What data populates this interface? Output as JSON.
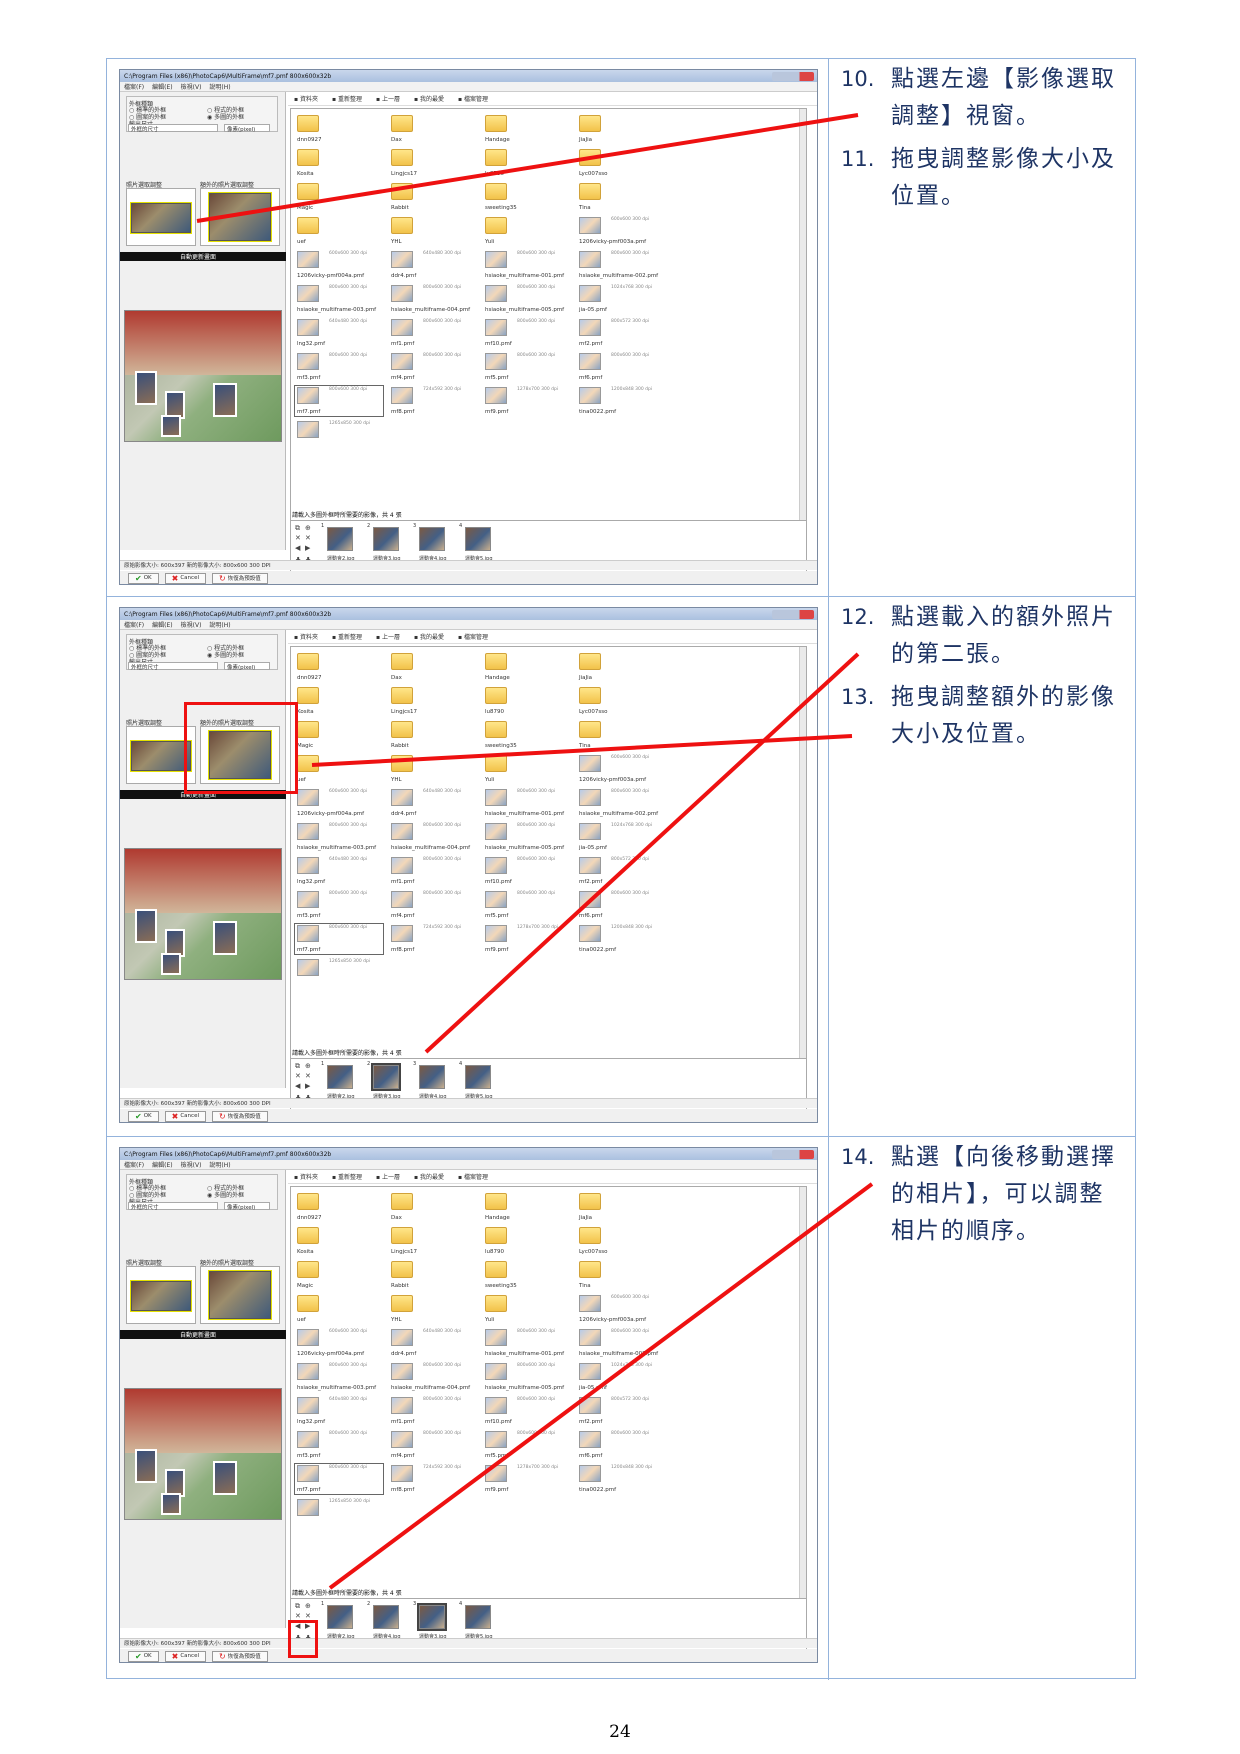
{
  "steps_rows": [
    [
      {
        "num": "10.",
        "text": "點選左邊【影像選取調整】視窗。"
      },
      {
        "num": "11.",
        "text": "拖曳調整影像大小及位置。"
      }
    ],
    [
      {
        "num": "12.",
        "text": "點選載入的額外照片的第二張。"
      },
      {
        "num": "13.",
        "text": "拖曳調整額外的影像大小及位置。"
      }
    ],
    [
      {
        "num": "14.",
        "text": "點選【向後移動選擇的相片】，可以調整相片的順序。"
      }
    ]
  ],
  "page_number": "24",
  "app": {
    "title": "C:\\Program Files (x86)\\PhotoCap6\\MultiFrame\\mf7.pmf  800x600x32b",
    "menus": [
      "檔案(F)",
      "編輯(E)",
      "檢視(V)",
      "說明(H)"
    ],
    "group_title": "外框種類",
    "radio_a": "圖案的外框",
    "radio_b": "標準的外框",
    "radio_c": "程式的外框",
    "radio_d": "多圖的外框",
    "output_size_label": "輸出尺寸",
    "output_size_value": "外框的尺寸",
    "unit_value": "像素(pixel)",
    "photo_adjust_label": "照片選取調整",
    "extra_adjust_label": "額外的照片選取調整",
    "auto_update": "自動更新畫面",
    "toolbar": [
      "資料夾",
      "重新整理",
      "上一層",
      "我的最愛",
      "檔案管理"
    ],
    "files": [
      {
        "name": "dnn0927",
        "kind": "folder"
      },
      {
        "name": "Dax",
        "kind": "folder"
      },
      {
        "name": "Handage",
        "kind": "folder"
      },
      {
        "name": "JiaJia",
        "kind": "folder"
      },
      {
        "name": "Kosita",
        "kind": "folder"
      },
      {
        "name": "Lingjcs17",
        "kind": "folder"
      },
      {
        "name": "lu8790",
        "kind": "folder"
      },
      {
        "name": "Lyc007sso",
        "kind": "folder"
      },
      {
        "name": "Magic",
        "kind": "folder"
      },
      {
        "name": "Rabbit",
        "kind": "folder"
      },
      {
        "name": "sweeting35",
        "kind": "folder"
      },
      {
        "name": "Tina",
        "kind": "folder"
      },
      {
        "name": "uef",
        "kind": "folder"
      },
      {
        "name": "YHL",
        "kind": "folder"
      },
      {
        "name": "Yuli",
        "kind": "folder"
      },
      {
        "name": "1206vicky-pmf003a.pmf",
        "kind": "file",
        "meta": "600x600 300 dpi"
      },
      {
        "name": "1206vicky-pmf004a.pmf",
        "kind": "file",
        "meta": "600x600 300 dpi"
      },
      {
        "name": "ddr4.pmf",
        "kind": "file",
        "meta": "640x480 300 dpi"
      },
      {
        "name": "hsiaoke_multiframe-001.pmf",
        "kind": "file",
        "meta": "800x600 300 dpi"
      },
      {
        "name": "hsiaoke_multiframe-002.pmf",
        "kind": "file",
        "meta": "800x600 300 dpi"
      },
      {
        "name": "hsiaoke_multiframe-003.pmf",
        "kind": "file",
        "meta": "800x600 300 dpi"
      },
      {
        "name": "hsiaoke_multiframe-004.pmf",
        "kind": "file",
        "meta": "800x600 300 dpi"
      },
      {
        "name": "hsiaoke_multiframe-005.pmf",
        "kind": "file",
        "meta": "800x600 300 dpi"
      },
      {
        "name": "jia-05.pmf",
        "kind": "file",
        "meta": "1024x768 300 dpi"
      },
      {
        "name": "lng32.pmf",
        "kind": "file",
        "meta": "640x480 300 dpi"
      },
      {
        "name": "mf1.pmf",
        "kind": "file",
        "meta": "800x600 300 dpi"
      },
      {
        "name": "mf10.pmf",
        "kind": "file",
        "meta": "800x600 300 dpi"
      },
      {
        "name": "mf2.pmf",
        "kind": "file",
        "meta": "800x572 300 dpi"
      },
      {
        "name": "mf3.pmf",
        "kind": "file",
        "meta": "800x600 300 dpi"
      },
      {
        "name": "mf4.pmf",
        "kind": "file",
        "meta": "800x600 300 dpi"
      },
      {
        "name": "mf5.pmf",
        "kind": "file",
        "meta": "800x600 300 dpi"
      },
      {
        "name": "mf6.pmf",
        "kind": "file",
        "meta": "800x600 300 dpi"
      },
      {
        "name": "mf7.pmf",
        "kind": "file",
        "meta": "800x600 300 dpi"
      },
      {
        "name": "mf8.pmf",
        "kind": "file",
        "meta": "724x592 300 dpi"
      },
      {
        "name": "mf9.pmf",
        "kind": "file",
        "meta": "1278x700 300 dpi"
      },
      {
        "name": "tina0022.pmf",
        "kind": "file",
        "meta": "1200x848 300 dpi"
      },
      {
        "name": "",
        "kind": "file",
        "meta": "1265x850 300 dpi"
      }
    ],
    "load_label": "請載入多圖外框時所需要的影像，共 4 張",
    "strip_sets": [
      [
        "運動會2.jpg",
        "運動會3.jpg",
        "運動會4.jpg",
        "運動會5.jpg"
      ],
      [
        "運動會2.jpg",
        "運動會3.jpg",
        "運動會4.jpg",
        "運動會5.jpg"
      ],
      [
        "運動會2.jpg",
        "運動會4.jpg",
        "運動會3.jpg",
        "運動會5.jpg"
      ]
    ],
    "status": "原始影像大小: 600x397   新的影像大小: 800x600 300 DPI",
    "ok": "OK",
    "cancel": "Cancel",
    "reset": "恢復為預設值"
  }
}
